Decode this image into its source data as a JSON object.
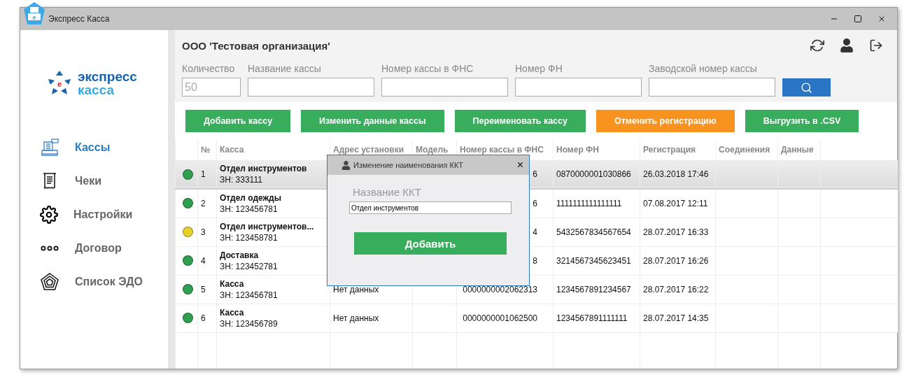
{
  "window": {
    "title": "Экспресс Касса",
    "icon_mark": "e"
  },
  "logo": {
    "line1": "экспресс",
    "line2": "касса",
    "mark": "e"
  },
  "sidebar": {
    "items": [
      {
        "label": "Кассы",
        "selected": true,
        "kind": "register"
      },
      {
        "label": "Чеки",
        "selected": false,
        "kind": "receipt"
      },
      {
        "label": "Настройки",
        "selected": false,
        "kind": "gear"
      },
      {
        "label": "Договор",
        "selected": false,
        "kind": "dots"
      },
      {
        "label": "Список ЭДО",
        "selected": false,
        "kind": "pentagon"
      }
    ]
  },
  "organization": "ООО 'Тестовая организация'",
  "filters": [
    {
      "label": "Количество",
      "placeholder": "50",
      "kind": "short"
    },
    {
      "label": "Название кассы",
      "kind": "long"
    },
    {
      "label": "Номер кассы в ФНС",
      "kind": "long"
    },
    {
      "label": "Номер ФН",
      "kind": "long"
    },
    {
      "label": "Заводской номер кассы",
      "kind": "long"
    }
  ],
  "actions": [
    {
      "label": "Добавить кассу",
      "kind": "primary"
    },
    {
      "label": "Изменить данные кассы",
      "kind": "primary"
    },
    {
      "label": "Переименовать кассу",
      "kind": "primary"
    },
    {
      "label": "Отменить регистрацию",
      "kind": "warning"
    },
    {
      "label": "Выгрузить в .CSV",
      "kind": "primary"
    }
  ],
  "table": {
    "columns": [
      "№",
      "Касса",
      "Адрес установки",
      "Модель",
      "Номер кассы в ФНС",
      "Номер ФН",
      "Регистрация",
      "Соединения",
      "Данные"
    ],
    "rows": [
      {
        "selected": true,
        "color": "#2e9e4f",
        "num": "1",
        "name": "Отдел инструментов",
        "serial": "ЗН: 333111",
        "address": "",
        "model": "",
        "fns": "6",
        "fn": "0870000001030866",
        "registered": "26.03.2018 17:46"
      },
      {
        "selected": false,
        "color": "#2e9e4f",
        "num": "2",
        "name": "Отдел одежды",
        "serial": "ЗН: 123456781",
        "address": "",
        "model": "",
        "fns": "6",
        "fn": "1111111111111111",
        "registered": "07.08.2017 12:11"
      },
      {
        "selected": false,
        "color": "#e8d22a",
        "num": "3",
        "name": "Отдел инструментов...",
        "serial": "ЗН: 123458781",
        "address": "",
        "model": "",
        "fns": "4",
        "fn": "5432567834567654",
        "registered": "28.07.2017 16:33"
      },
      {
        "selected": false,
        "color": "#2e9e4f",
        "num": "4",
        "name": "Доставка",
        "serial": "ЗН: 123452781",
        "address": "",
        "model": "",
        "fns": "8",
        "fn": "3214567345623451",
        "registered": "28.07.2017 16:26"
      },
      {
        "selected": false,
        "color": "#2e9e4f",
        "num": "5",
        "name": "Касса",
        "serial": "ЗН: 123456781",
        "address": "Нет данных",
        "model": "",
        "fns": "0000000002062313",
        "fn": "1234567891234567",
        "registered": "28.07.2017 16:22"
      },
      {
        "selected": false,
        "color": "#2e9e4f",
        "num": "6",
        "name": "Касса",
        "serial": "ЗН: 123456789",
        "address": "Нет данных",
        "model": "",
        "fns": "0000000001062500",
        "fn": "1234567891111111",
        "registered": "28.07.2017 14:35"
      }
    ]
  },
  "dialog": {
    "title": "Изменение наименования ККТ",
    "close": "×",
    "label": "Название ККТ",
    "value": "Отдел инструментов",
    "button": "Добавить"
  }
}
